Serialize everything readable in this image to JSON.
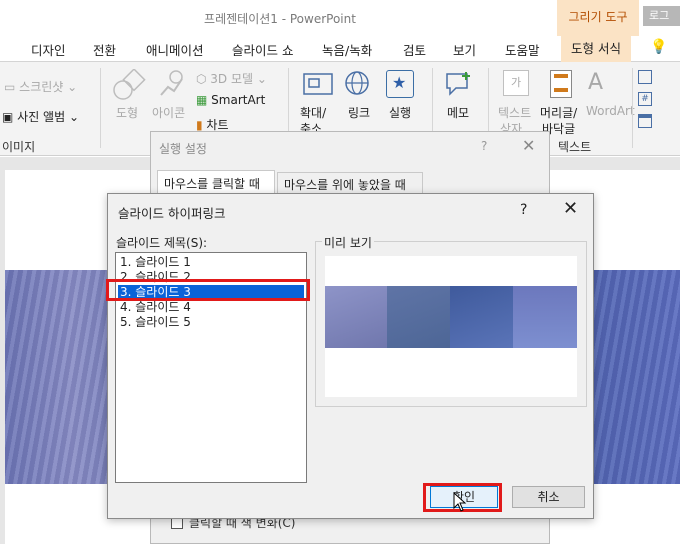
{
  "titlebar": {
    "app_title": "프레젠테이션1  -  PowerPoint",
    "contextual_tab": "그리기 도구",
    "login": "로그"
  },
  "ribbon_tabs": [
    "디자인",
    "전환",
    "애니메이션",
    "슬라이드 쇼",
    "녹음/녹화",
    "검토",
    "보기",
    "도움말",
    "도형 서식"
  ],
  "ribbon": {
    "screenshot": "스크린샷",
    "photo_album": "사진 앨범",
    "image_group": "이미지",
    "shapes": "도형",
    "icons": "아이콘",
    "model3d": "3D 모델",
    "smartart": "SmartArt",
    "chart": "차트",
    "zoom_line1": "확대/",
    "zoom_line2": "축소",
    "link": "링크",
    "action": "실행",
    "comment": "메모",
    "textbox_line1": "텍스트",
    "textbox_line2": "상자",
    "headerfooter_line1": "머리글/",
    "headerfooter_line2": "바닥글",
    "wordart": "WordArt",
    "text_group": "텍스트"
  },
  "background_dialog": {
    "title": "실행 설정",
    "help": "?",
    "close": "✕",
    "tab_click": "마우스를 클릭할 때",
    "tab_hover": "마우스를 위에 놓았을 때",
    "highlight_check": "클릭할 때 색 변화(C)"
  },
  "dialog": {
    "title": "슬라이드 하이퍼링크",
    "help": "?",
    "close": "✕",
    "list_label": "슬라이드 제목(S):",
    "slides": [
      "1. 슬라이드 1",
      "2. 슬라이드 2",
      "3. 슬라이드 3",
      "4. 슬라이드 4",
      "5. 슬라이드 5"
    ],
    "selected_index": 2,
    "preview_label": "미리 보기",
    "ok": "확인",
    "cancel": "취소"
  },
  "colors": {
    "accent_tab": "#fbe3c5",
    "selection": "#0a63d8",
    "highlight_red": "#e11a1a"
  }
}
